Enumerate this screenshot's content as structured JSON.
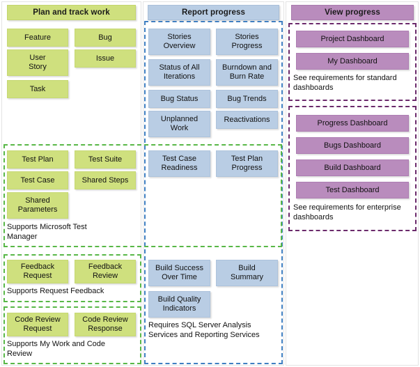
{
  "columns": {
    "left": {
      "title": "Plan and track work",
      "color": "#cfe07e"
    },
    "mid": {
      "title": "Report progress",
      "color": "#b9cde4"
    },
    "right": {
      "title": "View progress",
      "color": "#b98cbd"
    }
  },
  "work_items": [
    {
      "label": "Feature"
    },
    {
      "label": "Bug"
    },
    {
      "label": "User\nStory"
    },
    {
      "label": "Issue"
    },
    {
      "label": "Task"
    }
  ],
  "test_group": {
    "items": [
      {
        "label": "Test Plan"
      },
      {
        "label": "Test Suite"
      },
      {
        "label": "Test Case"
      },
      {
        "label": "Shared Steps"
      },
      {
        "label": "Shared\nParameters"
      }
    ],
    "reports": [
      {
        "label": "Test Case\nReadiness"
      },
      {
        "label": "Test Plan\nProgress"
      }
    ],
    "note": "Supports Microsoft Test Manager"
  },
  "feedback_group": {
    "items": [
      {
        "label": "Feedback\nRequest"
      },
      {
        "label": "Feedback\nReview"
      }
    ],
    "note": "Supports Request Feedback"
  },
  "code_review_group": {
    "items": [
      {
        "label": "Code Review\nRequest"
      },
      {
        "label": "Code Review\nResponse"
      }
    ],
    "note": "Supports My Work and Code Review"
  },
  "reports_group": {
    "items": [
      {
        "label": "Stories\nOverview"
      },
      {
        "label": "Stories\nProgress"
      },
      {
        "label": "Status of All\nIterations"
      },
      {
        "label": "Burndown and\nBurn Rate"
      },
      {
        "label": "Bug Status"
      },
      {
        "label": "Bug Trends"
      },
      {
        "label": "Unplanned\nWork"
      },
      {
        "label": "Reactivations"
      }
    ]
  },
  "build_group": {
    "items": [
      {
        "label": "Build Success\nOver Time"
      },
      {
        "label": "Build\nSummary"
      },
      {
        "label": "Build Quality\nIndicators"
      }
    ],
    "note": "Requires SQL Server Analysis Services and Reporting Services"
  },
  "standard_dashboards": {
    "items": [
      {
        "label": "Project Dashboard"
      },
      {
        "label": "My Dashboard"
      }
    ],
    "note": "See requirements for standard dashboards"
  },
  "enterprise_dashboards": {
    "items": [
      {
        "label": "Progress Dashboard"
      },
      {
        "label": "Bugs Dashboard"
      },
      {
        "label": "Build Dashboard"
      },
      {
        "label": "Test Dashboard"
      }
    ],
    "note": "See requirements for enterprise dashboards"
  }
}
